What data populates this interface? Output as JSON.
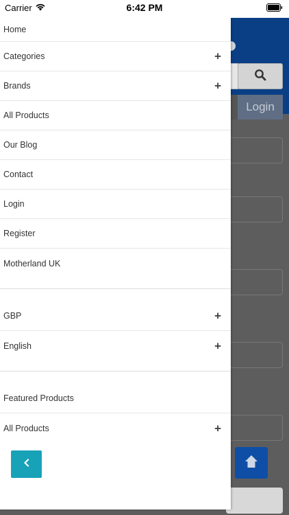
{
  "status_bar": {
    "carrier": "Carrier",
    "time": "6:42 PM"
  },
  "background": {
    "login_label": "Login",
    "header_color": "#0a3f86",
    "scroll_top_color": "#0f4ea6"
  },
  "drawer": {
    "main_items": [
      {
        "label": "Home",
        "expandable": false
      },
      {
        "label": "Categories",
        "expandable": true
      },
      {
        "label": "Brands",
        "expandable": true
      },
      {
        "label": "All Products",
        "expandable": false
      },
      {
        "label": "Our Blog",
        "expandable": false
      },
      {
        "label": "Contact",
        "expandable": false
      },
      {
        "label": "Login",
        "expandable": false
      },
      {
        "label": "Register",
        "expandable": false
      },
      {
        "label": "Motherland UK",
        "expandable": false
      }
    ],
    "settings_items": [
      {
        "label": "GBP",
        "expandable": true
      },
      {
        "label": "English",
        "expandable": true
      }
    ],
    "product_items": [
      {
        "label": "Featured Products",
        "expandable": false
      },
      {
        "label": "All Products",
        "expandable": true
      }
    ],
    "expand_symbol": "+",
    "back_button_color": "#17a2b8"
  }
}
